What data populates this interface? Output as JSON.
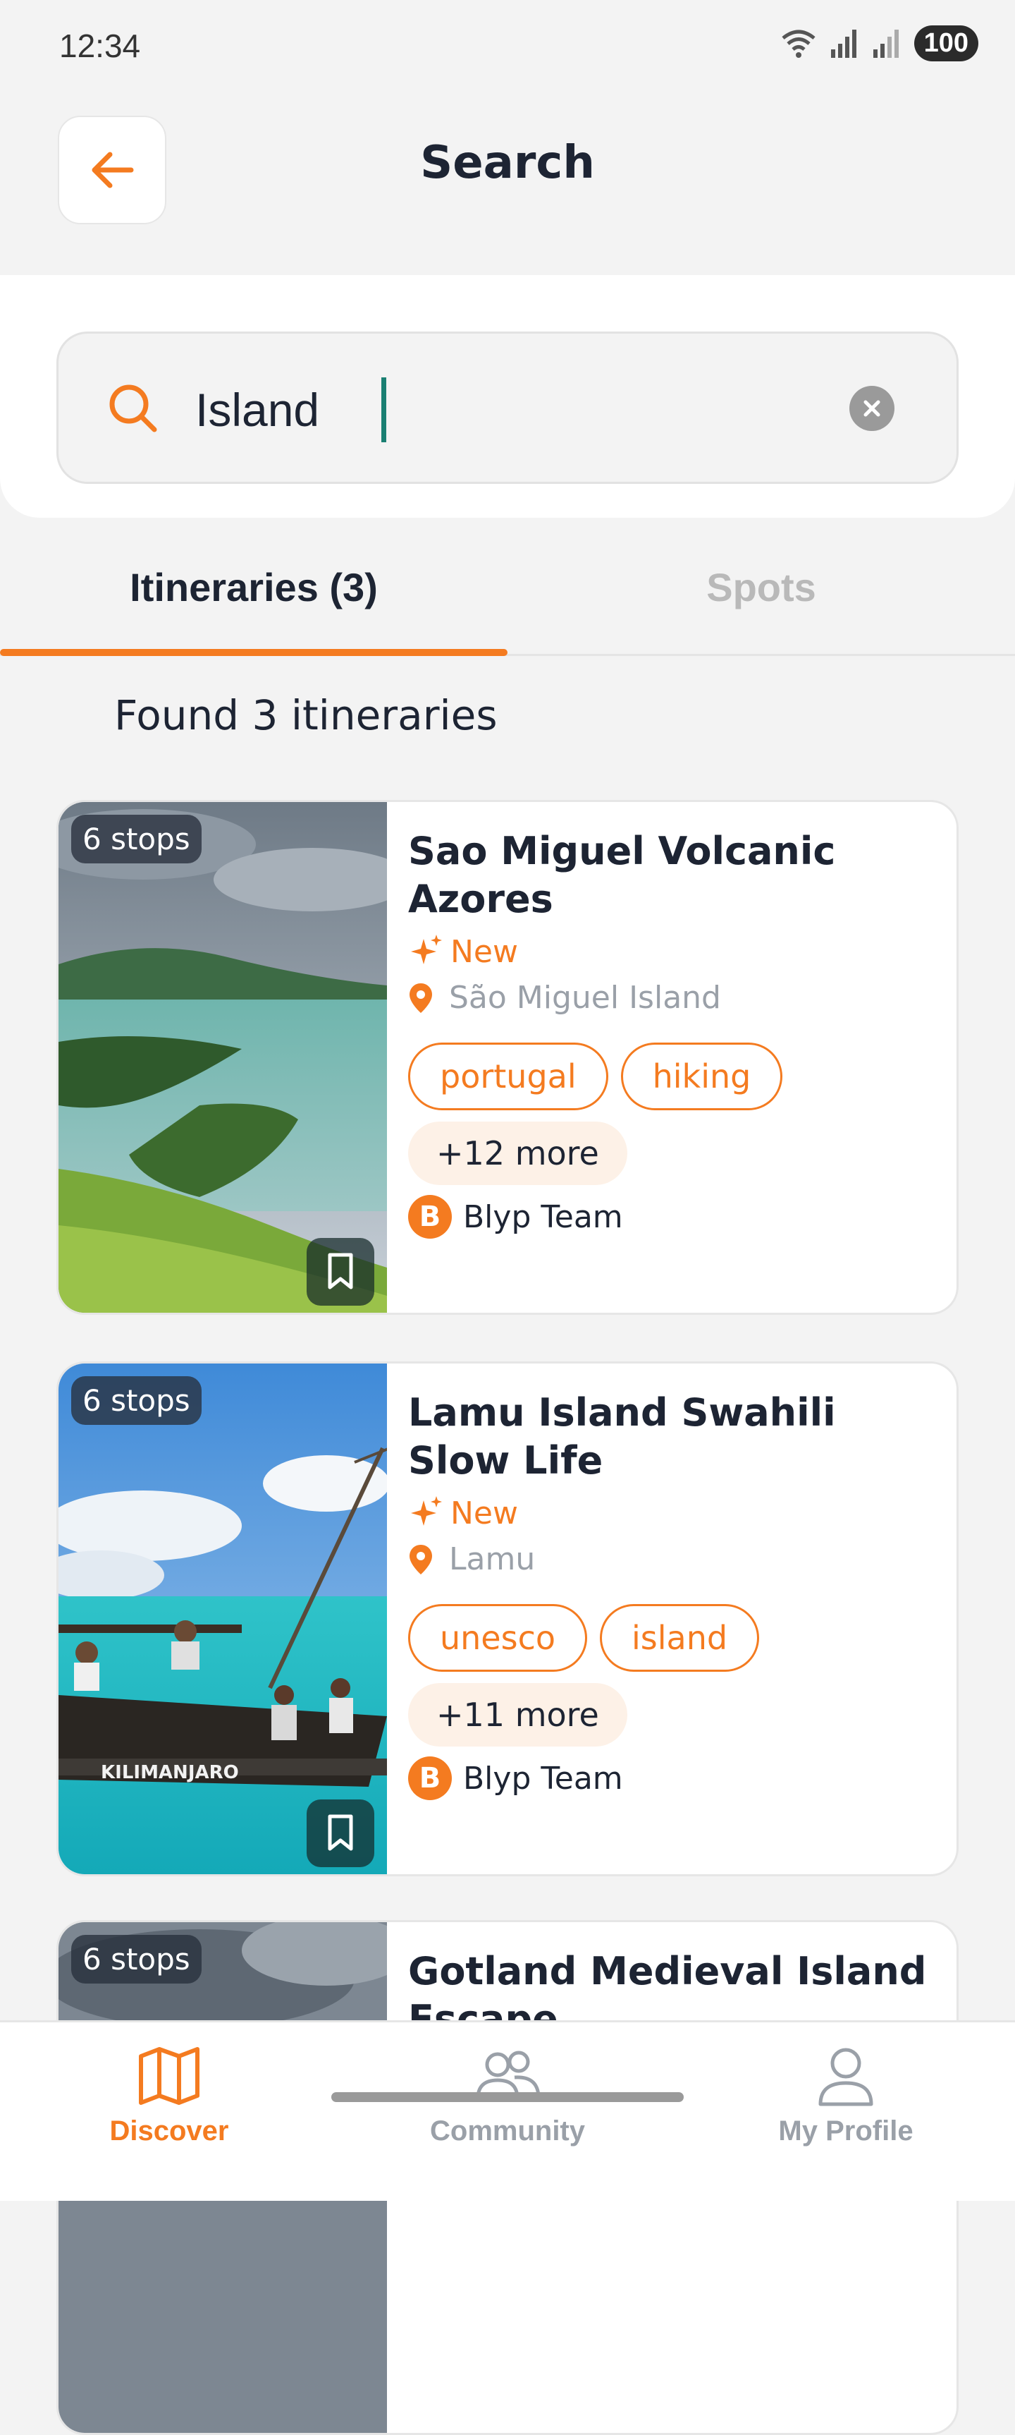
{
  "status_bar": {
    "time": "12:34",
    "battery": "100",
    "icons": [
      "wifi-icon",
      "signal-icon",
      "signal-icon",
      "battery-icon"
    ]
  },
  "header": {
    "title": "Search",
    "back_icon": "arrow-left-icon"
  },
  "search": {
    "value": "Island",
    "icon": "search-icon",
    "clear_icon": "clear-icon"
  },
  "tabs": [
    {
      "label": "Itineraries (3)",
      "active": true
    },
    {
      "label": "Spots",
      "active": false
    }
  ],
  "results": {
    "summary": "Found 3 itineraries",
    "items": [
      {
        "stops": "6 stops",
        "title": "Sao Miguel Volcanic Azores",
        "status": "New",
        "location": "São Miguel Island",
        "tags": [
          "portugal",
          "hiking"
        ],
        "more": "+12 more",
        "author": "Blyp Team"
      },
      {
        "stops": "6 stops",
        "title": "Lamu Island Swahili Slow Life",
        "status": "New",
        "location": "Lamu",
        "tags": [
          "unesco",
          "island"
        ],
        "more": "+11 more",
        "author": "Blyp Team"
      },
      {
        "stops": "6 stops",
        "title": "Gotland Medieval Island Escape"
      }
    ]
  },
  "bottom_nav": [
    {
      "label": "Discover",
      "icon": "map-icon",
      "active": true
    },
    {
      "label": "Community",
      "icon": "people-icon",
      "active": false
    },
    {
      "label": "My Profile",
      "icon": "person-icon",
      "active": false
    }
  ],
  "colors": {
    "accent": "#f47b20",
    "text_primary": "#1d2433",
    "text_muted": "#9aa0a8",
    "inactive": "#b9b9b9",
    "caret": "#1a7f72"
  }
}
